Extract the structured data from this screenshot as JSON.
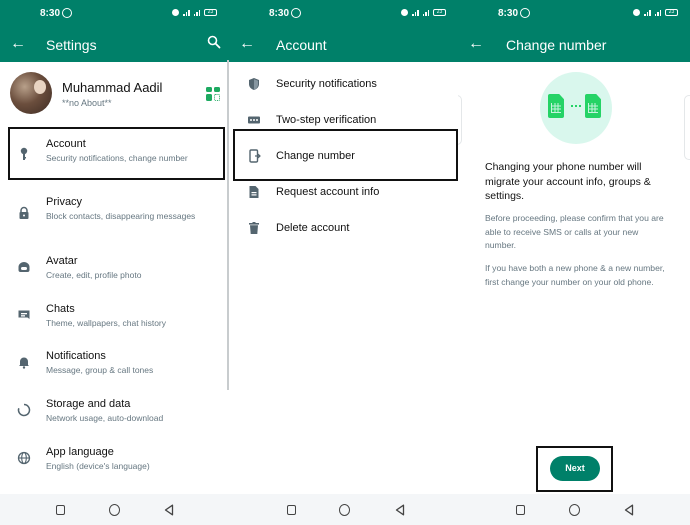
{
  "status_bar": {
    "time": "8:30",
    "battery": "23"
  },
  "settings": {
    "title": "Settings",
    "profile": {
      "name": "Muhammad Aadil",
      "about": "**no About**"
    },
    "items": [
      {
        "icon": "key-icon",
        "title": "Account",
        "subtitle": "Security notifications, change number"
      },
      {
        "icon": "lock-icon",
        "title": "Privacy",
        "subtitle": "Block contacts, disappearing messages"
      },
      {
        "icon": "avatar-icon",
        "title": "Avatar",
        "subtitle": "Create, edit, profile photo"
      },
      {
        "icon": "chat-icon",
        "title": "Chats",
        "subtitle": "Theme, wallpapers, chat history"
      },
      {
        "icon": "bell-icon",
        "title": "Notifications",
        "subtitle": "Message, group & call tones"
      },
      {
        "icon": "storage-icon",
        "title": "Storage and data",
        "subtitle": "Network usage, auto-download"
      },
      {
        "icon": "globe-icon",
        "title": "App language",
        "subtitle": "English (device's language)"
      }
    ]
  },
  "account": {
    "title": "Account",
    "items": [
      {
        "icon": "shield-icon",
        "label": "Security notifications"
      },
      {
        "icon": "dots-icon",
        "label": "Two-step verification"
      },
      {
        "icon": "change-number-icon",
        "label": "Change number"
      },
      {
        "icon": "document-icon",
        "label": "Request account info"
      },
      {
        "icon": "trash-icon",
        "label": "Delete account"
      }
    ]
  },
  "change_number": {
    "title": "Change number",
    "heading": "Changing your phone number will migrate your account info, groups & settings.",
    "paragraph1": "Before proceeding, please confirm that you are able to receive SMS or calls at your new number.",
    "paragraph2": "If you have both a new phone & a new number, first change your number on your old phone.",
    "next_label": "Next"
  },
  "colors": {
    "primary": "#008069",
    "accent": "#25d366",
    "secondary_text": "#667781"
  }
}
